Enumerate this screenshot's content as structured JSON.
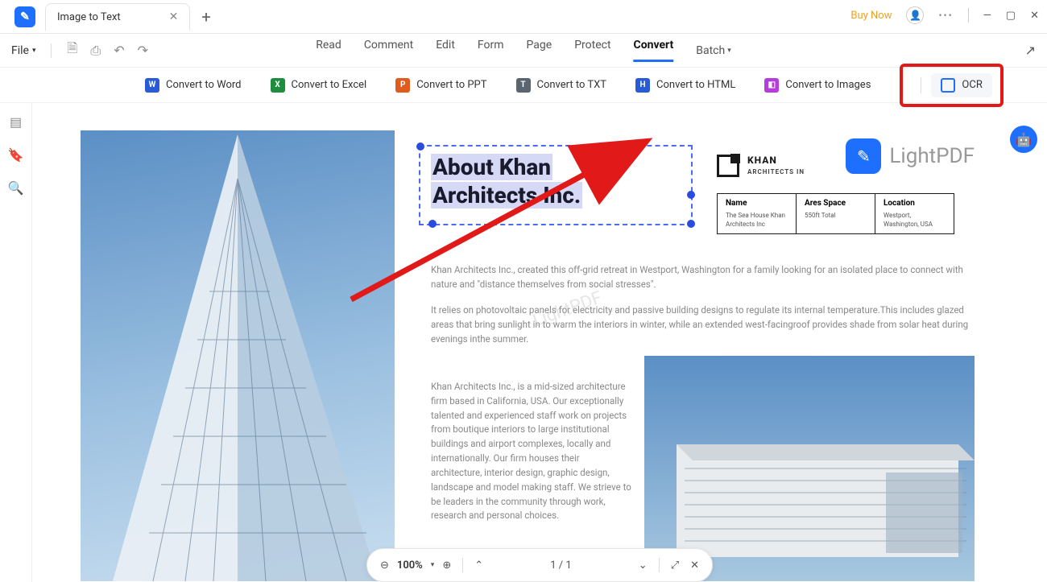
{
  "titlebar": {
    "tab_title": "Image to Text",
    "buy_now": "Buy Now"
  },
  "file_menu": "File",
  "tabs": {
    "read": "Read",
    "comment": "Comment",
    "edit": "Edit",
    "form": "Form",
    "page": "Page",
    "protect": "Protect",
    "convert": "Convert",
    "batch": "Batch"
  },
  "convert": {
    "word": "Convert to Word",
    "excel": "Convert to Excel",
    "ppt": "Convert to PPT",
    "txt": "Convert to TXT",
    "html": "Convert to HTML",
    "images": "Convert to Images",
    "ocr": "OCR"
  },
  "doc": {
    "title_l1": "About Khan",
    "title_l2": "Architects Inc.",
    "brand_name": "KHAN",
    "brand_sub": "ARCHITECTS IN",
    "lightpdf": "LightPDF",
    "table": {
      "h1": "Name",
      "v1": "The Sea House Khan Architects Inc",
      "h2": "Ares Space",
      "v2": "550ft Total",
      "h3": "Location",
      "v3": "Westport, Washington, USA"
    },
    "p1": "Khan Architects Inc., created this off-grid retreat in Westport, Washington for a family looking for an isolated place to connect with nature and \"distance themselves from social stresses\".",
    "p2": "It relies on photovoltaic panels for electricity and passive building designs to regulate its internal temperature.This includes glazed areas that bring sunlight in to warm the interiors in winter, while an extended west-facingroof provides shade from solar heat during evenings inthe summer.",
    "p3": "Khan Architects Inc., is a mid-sized architecture firm based in California, USA. Our exceptionally talented and experienced staff work on projects from boutique interiors to large institutional buildings and airport complexes, locally and internationally. Our firm houses their architecture, interior design, graphic design, landscape and model making staff. We strieve to be leaders in the community through work, research and personal choices."
  },
  "bottom": {
    "zoom": "100%",
    "page": "1 / 1"
  }
}
